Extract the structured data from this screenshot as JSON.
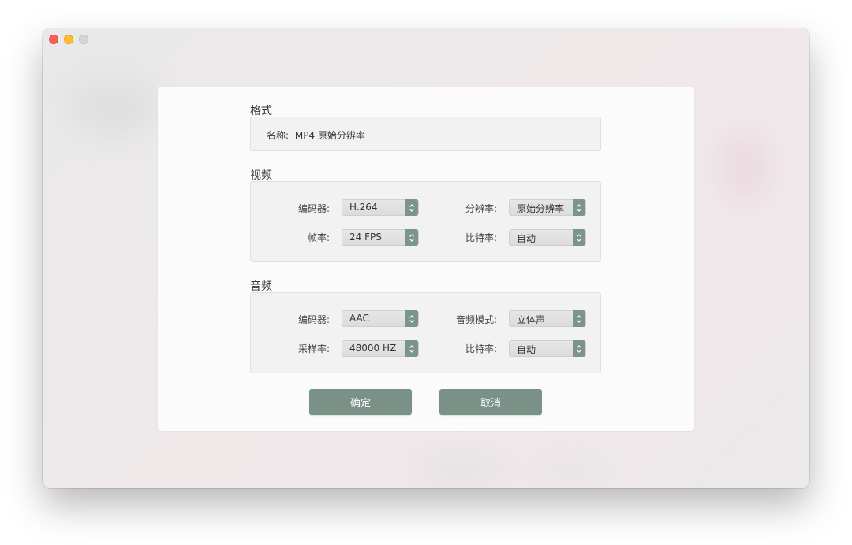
{
  "format": {
    "title": "格式",
    "name_label": "名称:",
    "name_value": "MP4 原始分辨率"
  },
  "video": {
    "title": "视频",
    "encoder_label": "编码器:",
    "encoder_value": "H.264",
    "resolution_label": "分辨率:",
    "resolution_value": "原始分辨率",
    "framerate_label": "帧率:",
    "framerate_value": "24 FPS",
    "bitrate_label": "比特率:",
    "bitrate_value": "自动"
  },
  "audio": {
    "title": "音频",
    "encoder_label": "编码器:",
    "encoder_value": "AAC",
    "mode_label": "音频模式:",
    "mode_value": "立体声",
    "samplerate_label": "采样率:",
    "samplerate_value": "48000 HZ",
    "bitrate_label": "比特率:",
    "bitrate_value": "自动"
  },
  "buttons": {
    "confirm": "确定",
    "cancel": "取消"
  },
  "colors": {
    "accent": "#799186",
    "close": "#fe5f57",
    "minimize": "#febc2e",
    "zoom_disabled": "#d6d6d6"
  },
  "icons": {
    "stepper": "up-down-chevron-icon"
  }
}
